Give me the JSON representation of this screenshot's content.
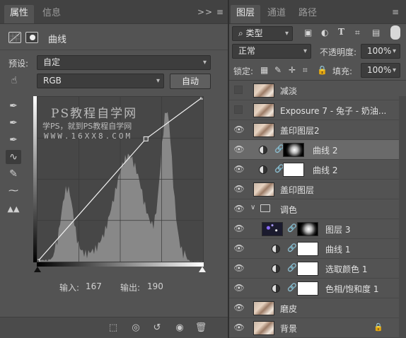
{
  "properties_panel": {
    "tabs": [
      {
        "label": "属性"
      },
      {
        "label": "信息"
      }
    ],
    "panel_controls": ">>  ≡",
    "adjustment_title": "曲线",
    "preset_label": "预设:",
    "preset_value": "自定",
    "channel_value": "RGB",
    "auto_button": "自动",
    "input_label": "输入:",
    "input_value": "167",
    "output_label": "输出:",
    "output_value": "190",
    "curve_point": {
      "input": 167,
      "output": 190
    },
    "watermark": {
      "line1": "PS教程自学网",
      "line2": "学PS，就到PS教程自学网",
      "line3": "WWW.16XX8.COM"
    }
  },
  "layers_panel": {
    "tabs": [
      {
        "label": "图层"
      },
      {
        "label": "通道"
      },
      {
        "label": "路径"
      }
    ],
    "filter_kind": "类型",
    "blend_mode": "正常",
    "opacity_label": "不透明度:",
    "opacity_value": "100%",
    "lock_label": "锁定:",
    "fill_label": "填充:",
    "fill_value": "100%",
    "layers": [
      {
        "name": "减淡",
        "visible": false,
        "type": "pixel"
      },
      {
        "name": "Exposure 7 - 兔子 - 奶油...",
        "visible": false,
        "type": "pixel"
      },
      {
        "name": "盖印图层2",
        "visible": true,
        "type": "pixel"
      },
      {
        "name": "曲线 2",
        "visible": true,
        "type": "adjustment-mask",
        "selected": true
      },
      {
        "name": "曲线 2",
        "visible": true,
        "type": "adjustment"
      },
      {
        "name": "盖印图层",
        "visible": true,
        "type": "pixel"
      },
      {
        "name": "调色",
        "visible": true,
        "type": "group"
      },
      {
        "name": "图层 3",
        "visible": true,
        "type": "pixel-mask"
      },
      {
        "name": "曲线 1",
        "visible": true,
        "type": "adjustment"
      },
      {
        "name": "选取颜色 1",
        "visible": true,
        "type": "adjustment"
      },
      {
        "name": "色相/饱和度 1",
        "visible": true,
        "type": "adjustment"
      },
      {
        "name": "磨皮",
        "visible": true,
        "type": "pixel"
      },
      {
        "name": "背景",
        "visible": true,
        "type": "pixel",
        "locked": true
      }
    ]
  },
  "colors": {
    "panel_bg": "#535353",
    "tab_bg": "#424242",
    "selected_row": "#6a6a6a"
  }
}
